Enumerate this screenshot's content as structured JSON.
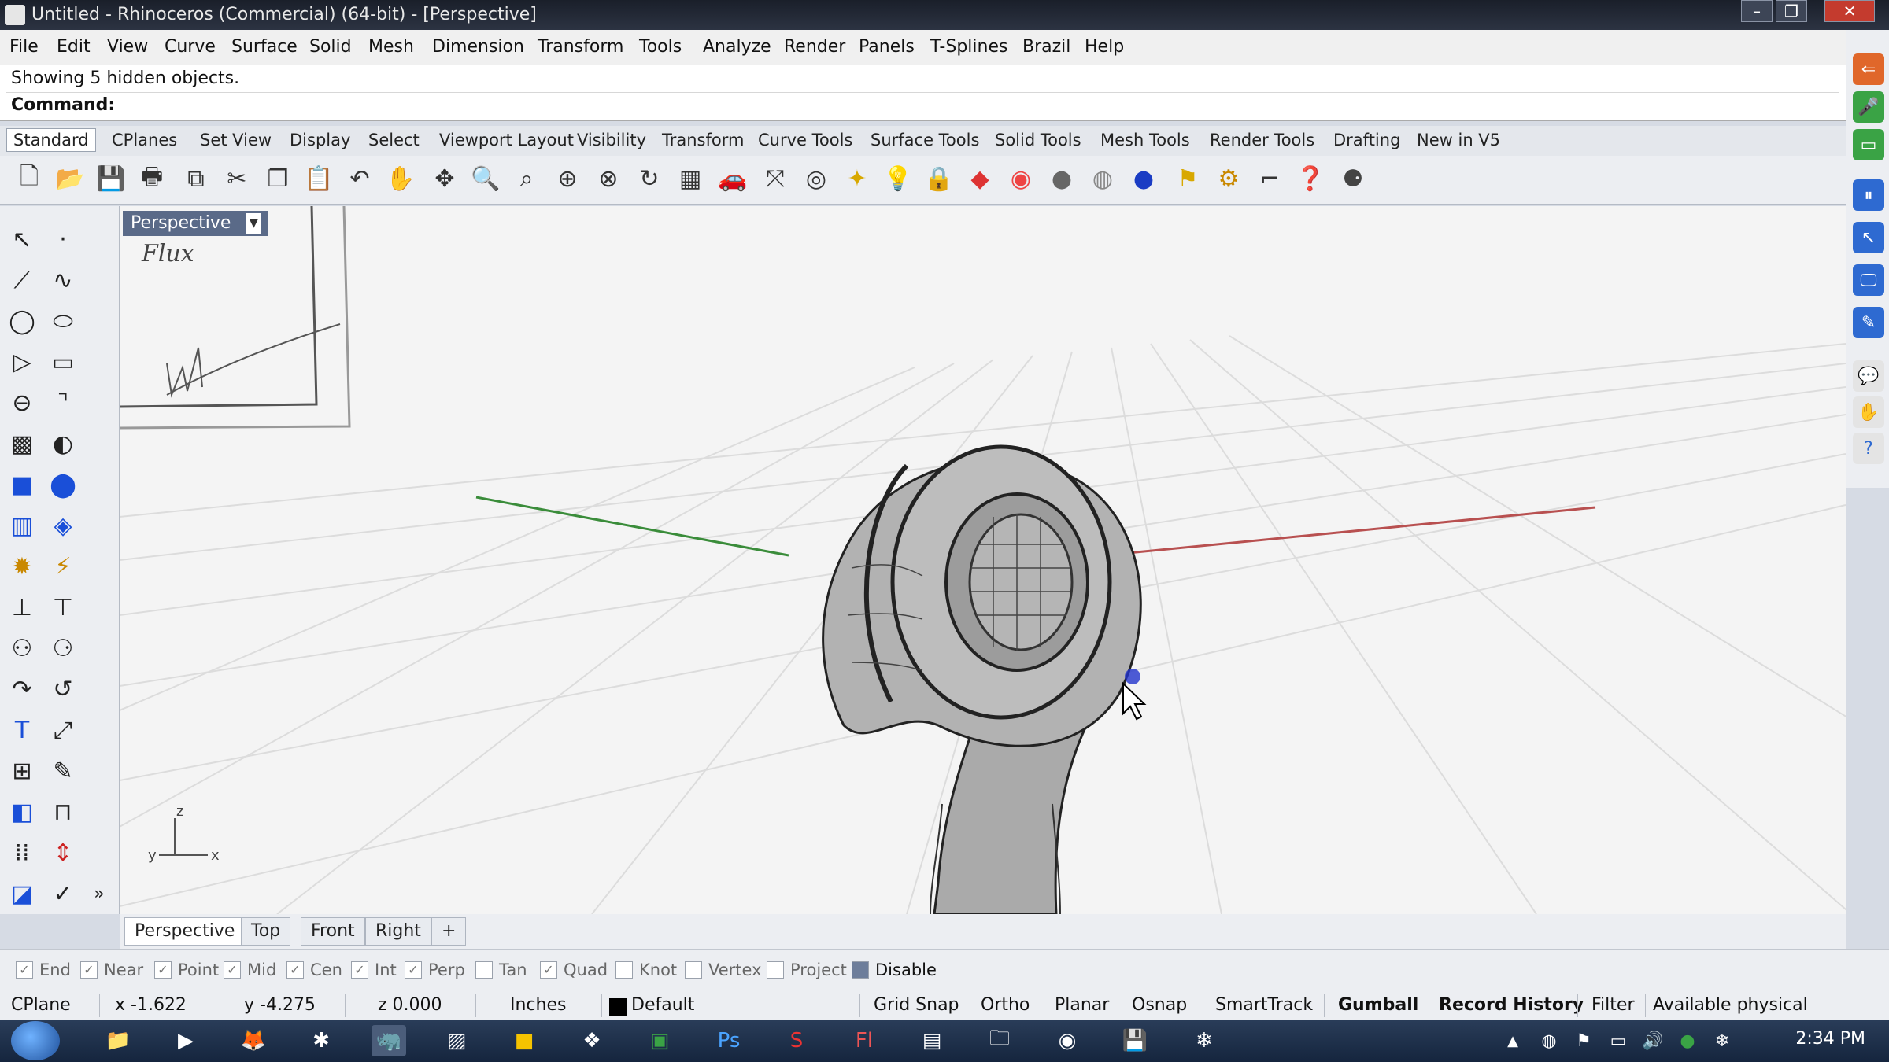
{
  "window": {
    "title": "Untitled - Rhinoceros (Commercial) (64-bit) - [Perspective]"
  },
  "menubar": [
    "File",
    "Edit",
    "View",
    "Curve",
    "Surface",
    "Solid",
    "Mesh",
    "Dimension",
    "Transform",
    "Tools",
    "Analyze",
    "Render",
    "Panels",
    "T-Splines",
    "Brazil",
    "Help"
  ],
  "command": {
    "history": "Showing 5 hidden objects.",
    "prompt": "Command:"
  },
  "toolbar_tabs": [
    "Standard",
    "CPlanes",
    "Set View",
    "Display",
    "Select",
    "Viewport Layout",
    "Visibility",
    "Transform",
    "Curve Tools",
    "Surface Tools",
    "Solid Tools",
    "Mesh Tools",
    "Render Tools",
    "Drafting",
    "New in V5"
  ],
  "viewport": {
    "title": "Perspective",
    "annotation": "Flux",
    "axis_labels": {
      "z": "z",
      "y": "y",
      "x": "x"
    }
  },
  "viewport_tabs": [
    "Perspective",
    "Top",
    "Front",
    "Right"
  ],
  "osnaps": [
    {
      "label": "End",
      "checked": true
    },
    {
      "label": "Near",
      "checked": true
    },
    {
      "label": "Point",
      "checked": true
    },
    {
      "label": "Mid",
      "checked": true
    },
    {
      "label": "Cen",
      "checked": true
    },
    {
      "label": "Int",
      "checked": true
    },
    {
      "label": "Perp",
      "checked": true
    },
    {
      "label": "Tan",
      "checked": false
    },
    {
      "label": "Quad",
      "checked": true
    },
    {
      "label": "Knot",
      "checked": false
    },
    {
      "label": "Vertex",
      "checked": false
    },
    {
      "label": "Project",
      "checked": false
    },
    {
      "label": "Disable",
      "checked": false
    }
  ],
  "status": {
    "cplane": "CPlane",
    "x": "x -1.622",
    "y": "y -4.275",
    "z": "z 0.000",
    "units": "Inches",
    "layer": "Default",
    "toggles": [
      "Grid Snap",
      "Ortho",
      "Planar",
      "Osnap",
      "SmartTrack",
      "Gumball",
      "Record History",
      "Filter"
    ],
    "memory": "Available physical memor..."
  },
  "taskbar": {
    "clock": "2:34 PM"
  },
  "colors": {
    "x_axis": "#b85050",
    "y_axis": "#3a8c3a",
    "viewport_title_bg": "#5a6a88"
  }
}
